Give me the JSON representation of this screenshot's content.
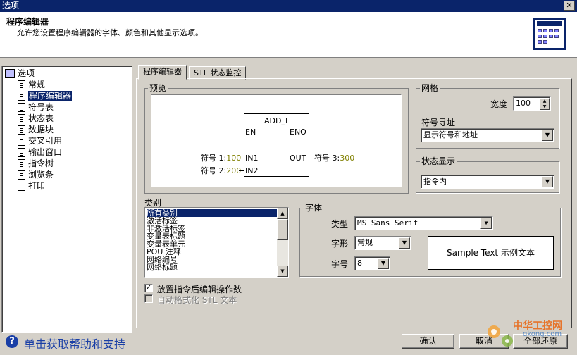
{
  "window": {
    "title": "选项",
    "close": "✕"
  },
  "header": {
    "title": "程序编辑器",
    "description": "允许您设置程序编辑器的字体、颜色和其他显示选项。"
  },
  "tree": {
    "root": "选项",
    "items": [
      {
        "label": "常规",
        "selected": false
      },
      {
        "label": "程序编辑器",
        "selected": true
      },
      {
        "label": "符号表",
        "selected": false
      },
      {
        "label": "状态表",
        "selected": false
      },
      {
        "label": "数据块",
        "selected": false
      },
      {
        "label": "交叉引用",
        "selected": false
      },
      {
        "label": "输出窗口",
        "selected": false
      },
      {
        "label": "指令树",
        "selected": false
      },
      {
        "label": "浏览条",
        "selected": false
      },
      {
        "label": "打印",
        "selected": false
      }
    ]
  },
  "tabs": [
    {
      "label": "程序编辑器",
      "active": true
    },
    {
      "label": "STL 状态监控",
      "active": false
    }
  ],
  "preview": {
    "label": "预览",
    "block_name": "ADD_I",
    "en": "EN",
    "eno": "ENO",
    "in1": "IN1",
    "in2": "IN2",
    "out": "OUT",
    "sym1_name": "符号 1",
    "sym1_val": "100",
    "sym2_name": "符号 2",
    "sym2_val": "200",
    "sym3_name": "符号 3",
    "sym3_val": "300",
    "sep": ":"
  },
  "grid": {
    "label": "网格",
    "width_label": "宽度",
    "width_value": "100"
  },
  "symbol_addressing": {
    "label": "符号寻址",
    "value": "显示符号和地址"
  },
  "status_display": {
    "label": "状态显示",
    "value": "指令内"
  },
  "category": {
    "label": "类别",
    "items": [
      "所有类别",
      "激活标签",
      "非激活标签",
      "变量表标题",
      "变量表单元",
      "POU 注释",
      "网络编号",
      "网络标题"
    ],
    "selected_index": 0
  },
  "font": {
    "label": "字体",
    "type_label": "类型",
    "type_value": "MS Sans Serif",
    "style_label": "字形",
    "style_value": "常规",
    "size_label": "字号",
    "size_value": "8",
    "sample": "Sample Text 示例文本"
  },
  "options": {
    "edit_after_insert": {
      "label": "放置指令后编辑操作数",
      "checked": true
    },
    "auto_format_stl": {
      "label": "自动格式化 STL 文本",
      "checked": false,
      "disabled": true
    }
  },
  "footer": {
    "help": "单击获取帮助和支持",
    "ok": "确认",
    "cancel": "取消",
    "restore": "全部还原"
  },
  "watermark": {
    "line1": "中华工控网",
    "line2": "gkong.com"
  },
  "colors": {
    "titlebar": "#0a246a",
    "selection": "#0a246a",
    "symbol_value": "#808000",
    "help_link": "#1a3fa6"
  }
}
